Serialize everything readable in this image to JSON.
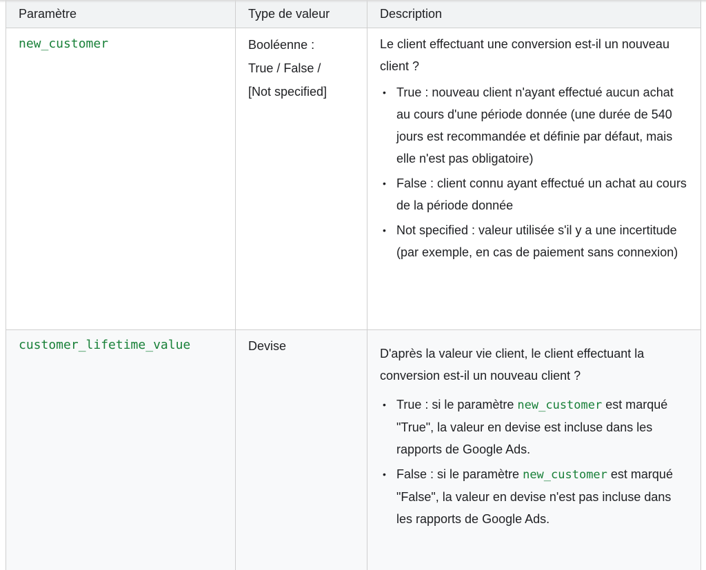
{
  "table": {
    "headers": {
      "param": "Paramètre",
      "type": "Type de valeur",
      "desc": "Description"
    },
    "rows": [
      {
        "param": "new_customer",
        "type_lines": [
          "Booléenne :",
          "True / False /",
          "[Not specified]"
        ],
        "intro": "Le client effectuant une conversion est-il un nouveau client ?",
        "bullets": [
          {
            "text": "True : nouveau client n'ayant effectué aucun achat au cours d'une période donnée (une durée de 540 jours est recommandée et définie par défaut, mais elle n'est pas obligatoire)"
          },
          {
            "text": "False : client connu ayant effectué un achat au cours de la période donnée"
          },
          {
            "text": "Not specified : valeur utilisée s'il y a une incertitude (par exemple, en cas de paiement sans connexion)"
          }
        ]
      },
      {
        "param": "customer_lifetime_value",
        "type_lines": [
          "Devise"
        ],
        "intro": "D'après la valeur vie client, le client effectuant la conversion est-il un nouveau client ?",
        "bullets": [
          {
            "pre": "True : si le paramètre ",
            "code": "new_customer",
            "post": " est marqué \"True\", la valeur en devise est incluse dans les rapports de Google Ads."
          },
          {
            "pre": "False : si le paramètre ",
            "code": "new_customer",
            "post": " est marqué \"False\", la valeur en devise n'est pas incluse dans les rapports de Google Ads."
          }
        ]
      }
    ]
  }
}
